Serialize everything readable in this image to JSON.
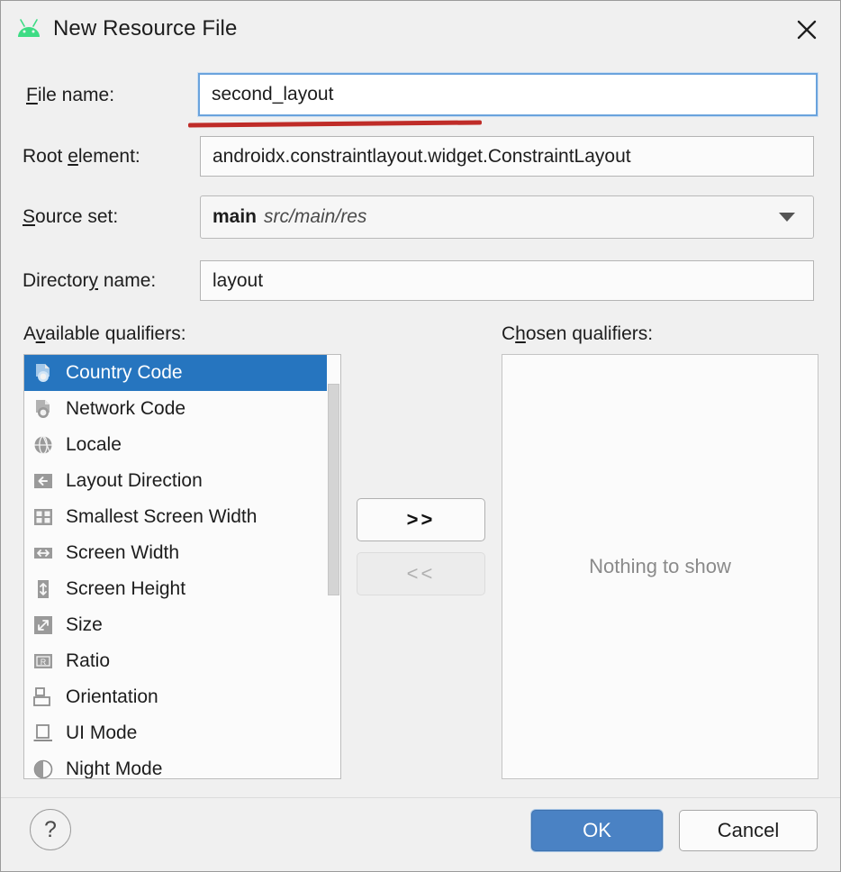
{
  "window": {
    "title": "New Resource File",
    "app_icon": "android-icon",
    "close_label": "✕"
  },
  "form": {
    "file_name": {
      "label_pre": "F",
      "label_mnemonic": "F",
      "label_text": "ile name:",
      "label_full": "File name:",
      "value": "second_layout"
    },
    "root_element": {
      "label_full": "Root element:",
      "value": "androidx.constraintlayout.widget.ConstraintLayout"
    },
    "source_set": {
      "label_full": "Source set:",
      "value_main": "main",
      "value_path": "src/main/res",
      "arrow_icon": "chevron-down-icon"
    },
    "directory_name": {
      "label_full": "Directory name:",
      "value": "layout"
    }
  },
  "qualifiers": {
    "available_label": "Available qualifiers:",
    "chosen_label": "Chosen qualifiers:",
    "available_items": [
      {
        "label": "Country Code",
        "icon": "country-code-icon",
        "selected": true
      },
      {
        "label": "Network Code",
        "icon": "network-code-icon",
        "selected": false
      },
      {
        "label": "Locale",
        "icon": "locale-globe-icon",
        "selected": false
      },
      {
        "label": "Layout Direction",
        "icon": "arrow-left-icon",
        "selected": false
      },
      {
        "label": "Smallest Screen Width",
        "icon": "smallest-width-icon",
        "selected": false
      },
      {
        "label": "Screen Width",
        "icon": "arrows-horizontal-icon",
        "selected": false
      },
      {
        "label": "Screen Height",
        "icon": "arrows-vertical-icon",
        "selected": false
      },
      {
        "label": "Size",
        "icon": "resize-diagonal-icon",
        "selected": false
      },
      {
        "label": "Ratio",
        "icon": "ratio-icon",
        "selected": false
      },
      {
        "label": "Orientation",
        "icon": "orientation-icon",
        "selected": false
      },
      {
        "label": "UI Mode",
        "icon": "ui-mode-icon",
        "selected": false
      },
      {
        "label": "Night Mode",
        "icon": "night-mode-icon",
        "selected": false
      }
    ],
    "chosen_empty_text": "Nothing to show",
    "move_right_label": ">>",
    "move_left_label": "<<"
  },
  "footer": {
    "help_label": "?",
    "ok_label": "OK",
    "cancel_label": "Cancel"
  },
  "colors": {
    "dialog_bg": "#f0f0f0",
    "selection_blue": "#2675bf",
    "focus_border_blue": "#6aa3dd",
    "primary_button_blue": "#4a82c4",
    "annotation_red": "#bf2c28",
    "android_green": "#3ddc84"
  }
}
